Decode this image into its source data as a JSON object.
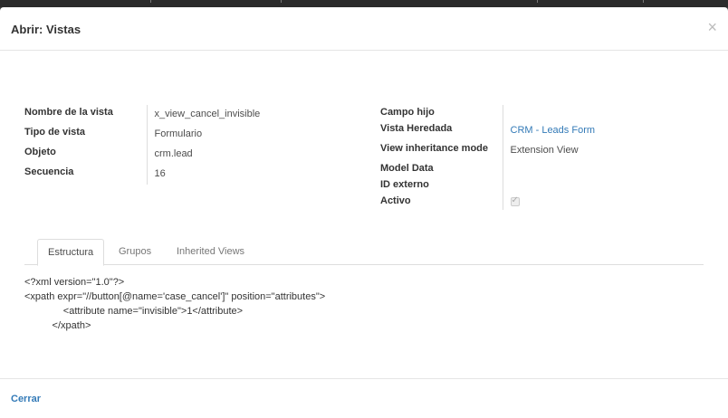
{
  "dialog": {
    "title": "Abrir: Vistas",
    "close_symbol": "×"
  },
  "left_fields": [
    {
      "label": "Nombre de la vista",
      "value": "x_view_cancel_invisible"
    },
    {
      "label": "Tipo de vista",
      "value": "Formulario"
    },
    {
      "label": "Objeto",
      "value": "crm.lead"
    },
    {
      "label": "Secuencia",
      "value": "16"
    }
  ],
  "right_fields": {
    "campo_hijo": {
      "label": "Campo hijo",
      "value": ""
    },
    "vista_heredada": {
      "label": "Vista Heredada",
      "value": "CRM - Leads Form"
    },
    "inheritance_mode": {
      "label": "View inheritance mode",
      "value": "Extension View"
    },
    "model_data": {
      "label": "Model Data",
      "value": ""
    },
    "id_externo": {
      "label": "ID externo",
      "value": ""
    },
    "activo": {
      "label": "Activo",
      "checked": true
    }
  },
  "tabs": [
    {
      "label": "Estructura",
      "active": true
    },
    {
      "label": "Grupos",
      "active": false
    },
    {
      "label": "Inherited Views",
      "active": false
    }
  ],
  "code_lines": [
    "<?xml version=\"1.0\"?>",
    "<xpath expr=\"//button[@name='case_cancel']\" position=\"attributes\">",
    "              <attribute name=\"invisible\">1</attribute>",
    "          </xpath>"
  ],
  "footer": {
    "close_label": "Cerrar"
  }
}
